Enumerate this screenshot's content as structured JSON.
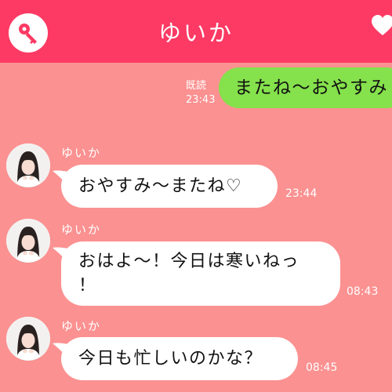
{
  "header": {
    "title": "ゆいか",
    "left_icon": "key-icon",
    "right_icon": "heart-icon",
    "color": "#fc3a64"
  },
  "outgoing": {
    "text": "またね〜おやすみ",
    "read_label": "既読",
    "time": "23:43",
    "color": "#85e14c"
  },
  "messages": [
    {
      "sender": "ゆいか",
      "lines": [
        "おやすみ〜またね♡"
      ],
      "time": "23:44"
    },
    {
      "sender": "ゆいか",
      "lines": [
        "おはよ〜！今日は寒いねっ",
        "！"
      ],
      "time": "08:43"
    },
    {
      "sender": "ゆいか",
      "lines": [
        "今日も忙しいのかな？"
      ],
      "time": "08:45"
    }
  ],
  "colors": {
    "background": "#fb9191",
    "bubble": "#ffffff"
  }
}
